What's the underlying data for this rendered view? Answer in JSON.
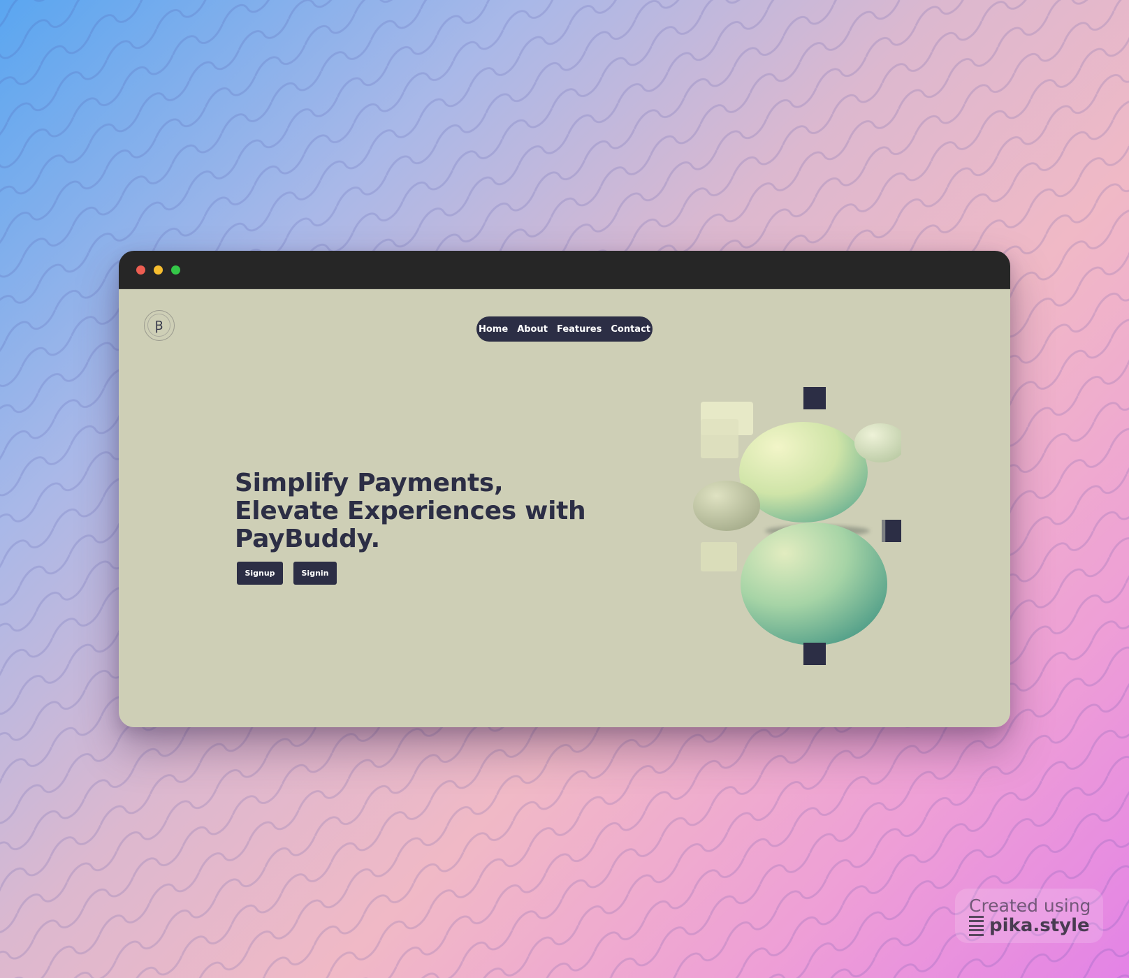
{
  "browser": {
    "controls": [
      "close",
      "minimize",
      "maximize"
    ]
  },
  "site": {
    "logo_glyph": "Ꞵ",
    "nav": {
      "items": [
        {
          "label": "Home"
        },
        {
          "label": "About"
        },
        {
          "label": "Features"
        },
        {
          "label": "Contact"
        }
      ]
    },
    "hero": {
      "headline_lines": [
        "Simplify Payments,",
        "Elevate Experiences with",
        "PayBuddy."
      ],
      "signup_label": "Signup",
      "signin_label": "Signin"
    }
  },
  "watermark": {
    "text": "Created using",
    "brand": "pika.style",
    "icon": "pika-stack-icon"
  },
  "colors": {
    "page_background": "#cecfb6",
    "accent_dark": "#2c2e45",
    "titlebar": "#262626"
  }
}
